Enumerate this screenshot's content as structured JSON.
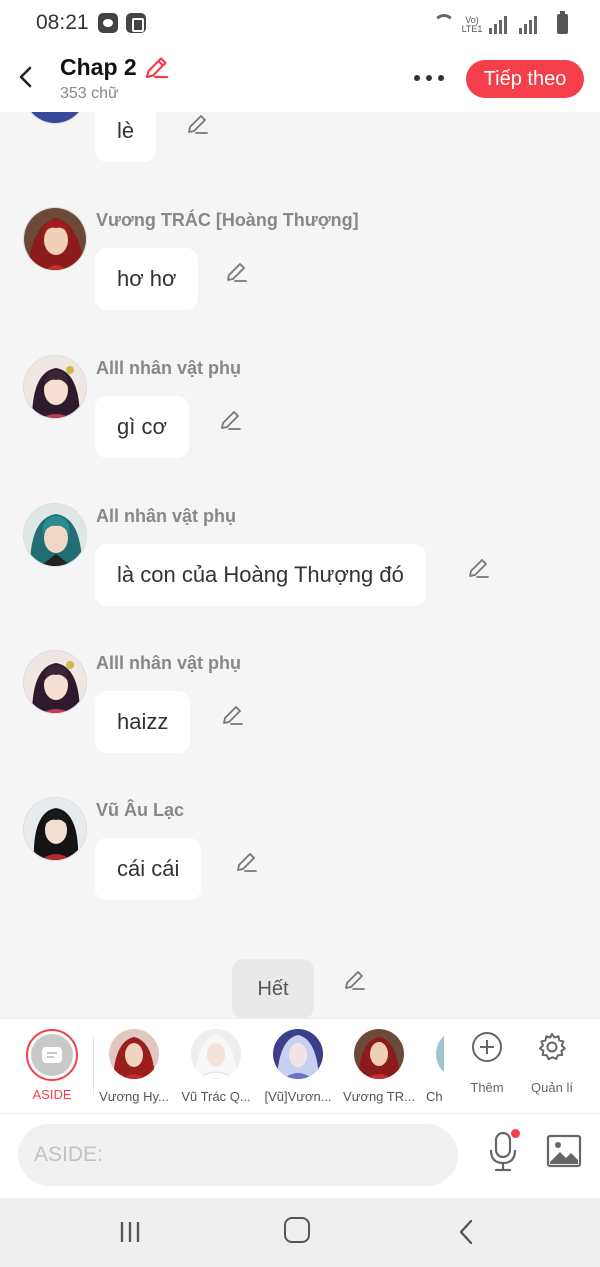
{
  "status_bar": {
    "time": "08:21",
    "network": "Vo) LTE1"
  },
  "header": {
    "title": "Chap 2",
    "word_count": "353 chữ",
    "next_label": "Tiếp theo"
  },
  "messages": [
    {
      "speaker": "",
      "text": "lè",
      "avatar": "blue-hair"
    },
    {
      "speaker": "Vương TRÁC [Hoàng Thượng]",
      "text": "hơ hơ",
      "avatar": "red-hair-man"
    },
    {
      "speaker": "Alll nhân vật phụ",
      "text": "gì cơ",
      "avatar": "dark-hair-girl"
    },
    {
      "speaker": "All nhân vật phụ",
      "text": "là con của Hoàng Thượng đó",
      "avatar": "teal-hair-man"
    },
    {
      "speaker": "Alll nhân vật phụ",
      "text": "haizz",
      "avatar": "dark-hair-girl"
    },
    {
      "speaker": "Vũ Âu Lạc",
      "text": "cái cái",
      "avatar": "black-hair-woman"
    }
  ],
  "end_label": "Hết",
  "characters": [
    {
      "name": "ASIDE"
    },
    {
      "name": "Vương Hy..."
    },
    {
      "name": "Vũ Trác Q..."
    },
    {
      "name": "[Vũ]Vươn..."
    },
    {
      "name": "Vương TR..."
    },
    {
      "name": "Ch"
    }
  ],
  "tools": {
    "add_label": "Thêm",
    "manage_label": "Quản lí"
  },
  "input": {
    "placeholder": "ASIDE:"
  },
  "colors": {
    "accent": "#f43f4a",
    "background": "#f5f5f5"
  }
}
